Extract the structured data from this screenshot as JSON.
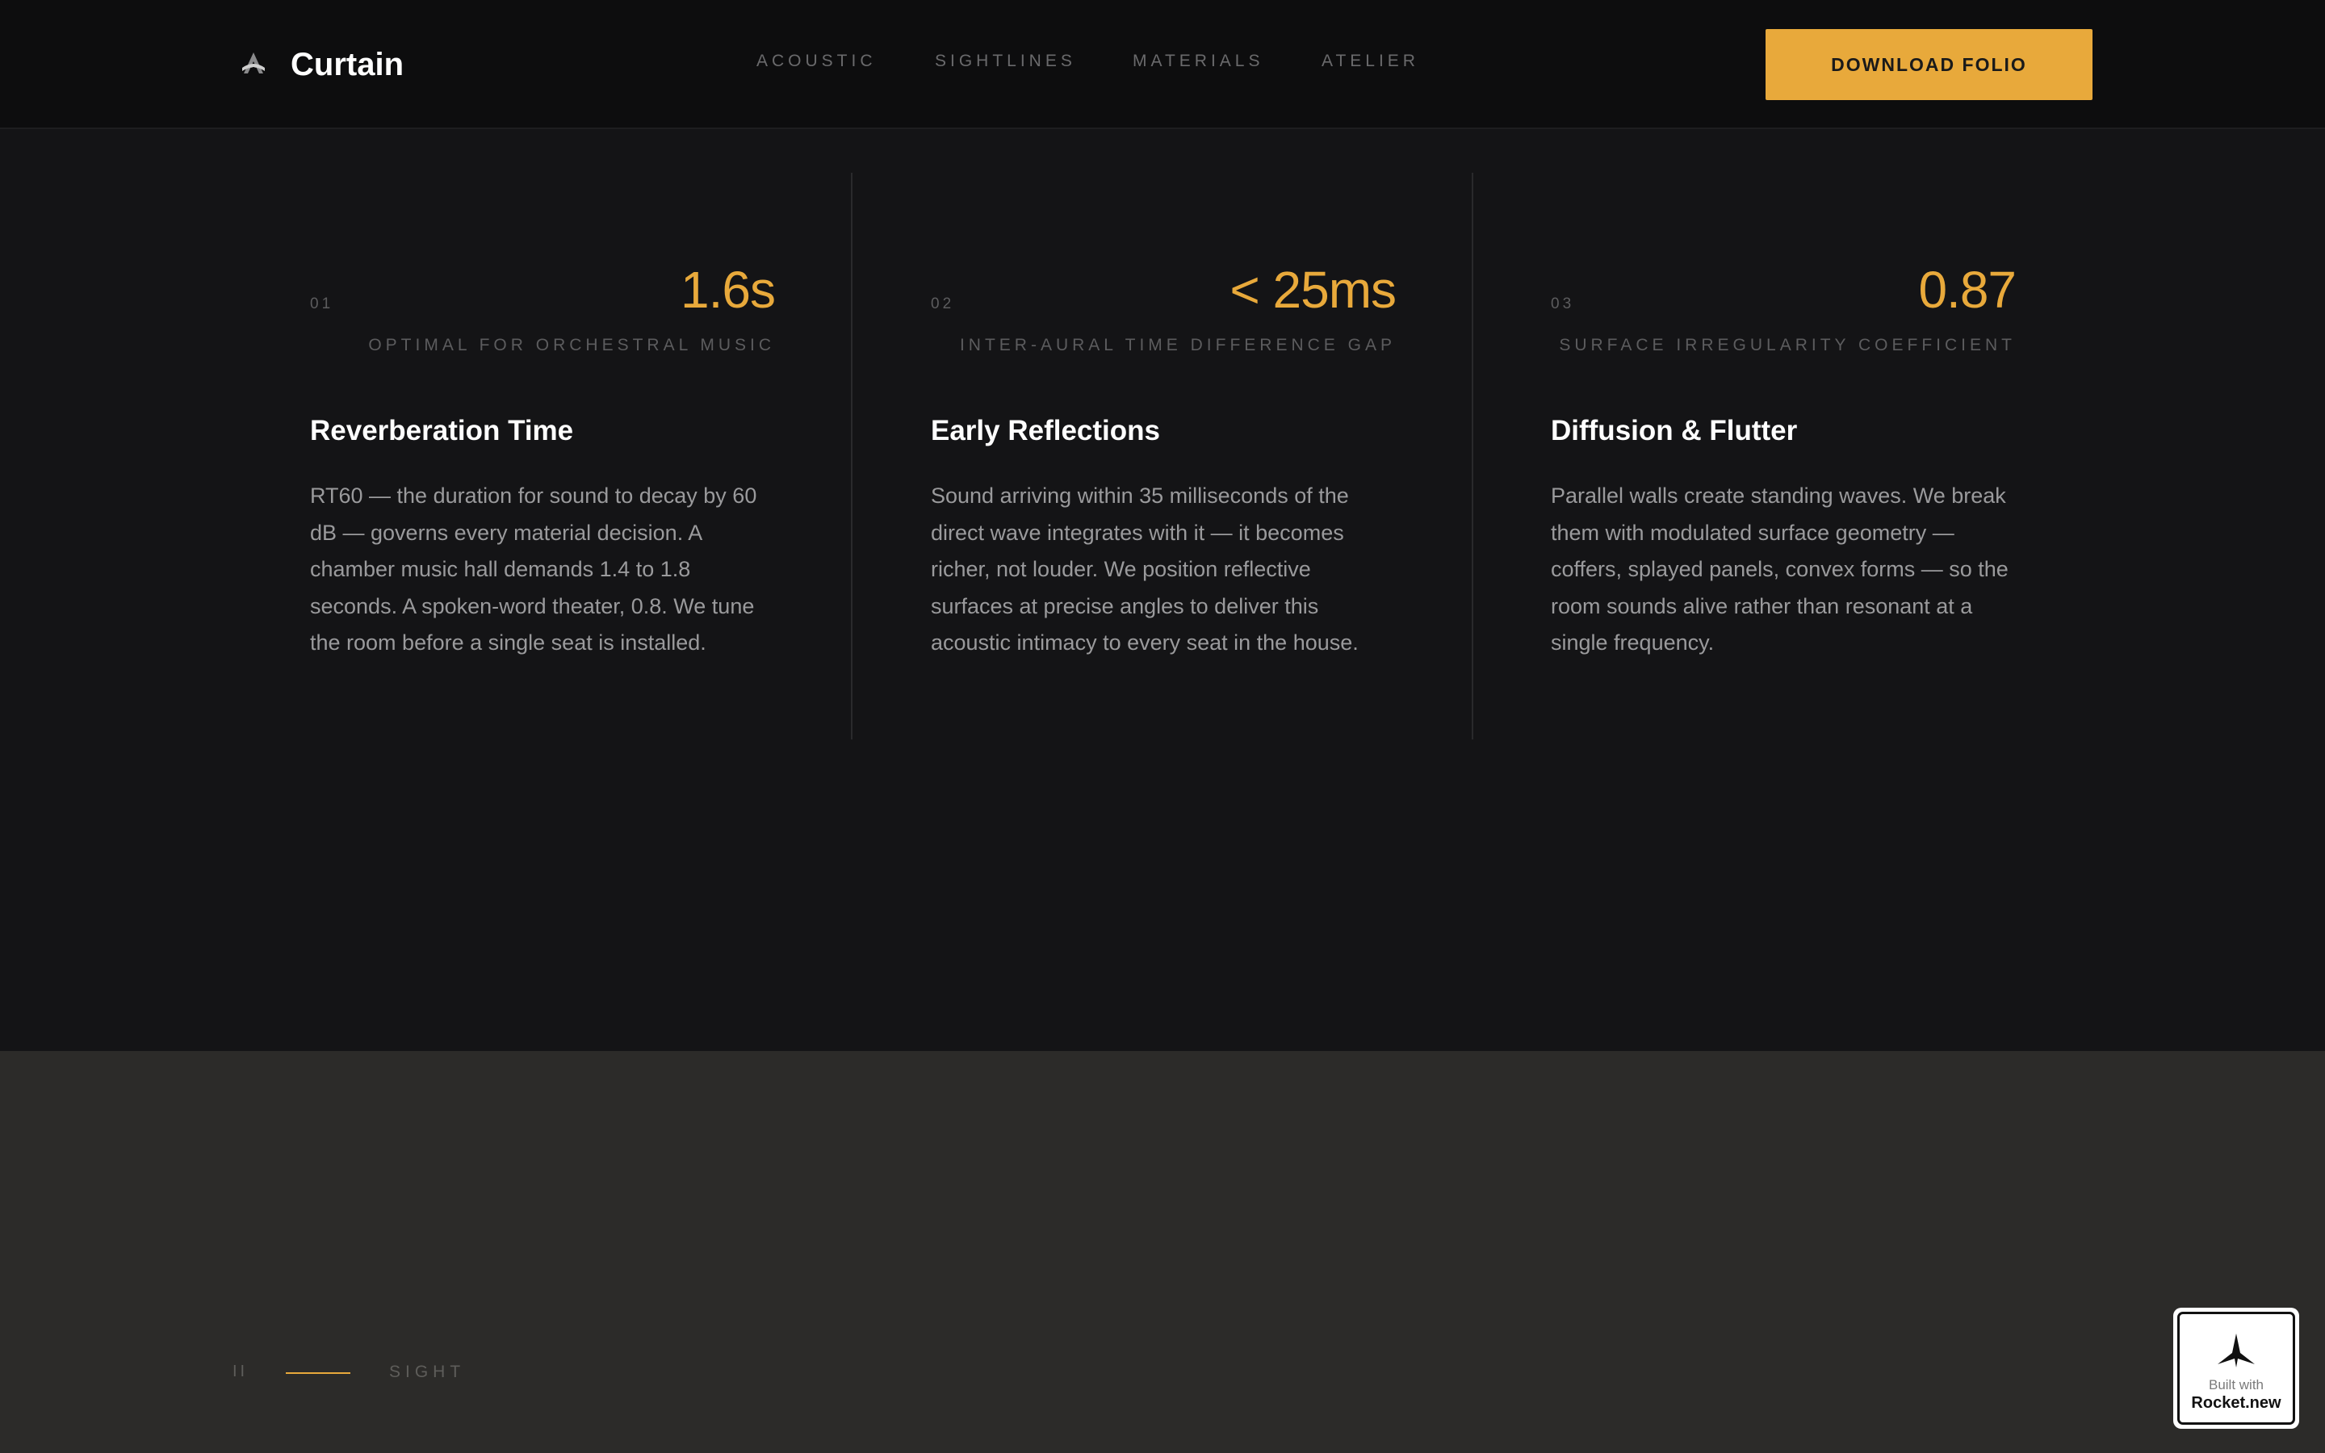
{
  "header": {
    "brand": "Curtain",
    "nav": [
      {
        "label": "ACOUSTIC"
      },
      {
        "label": "SIGHTLINES"
      },
      {
        "label": "MATERIALS"
      },
      {
        "label": "ATELIER"
      }
    ],
    "cta_label": "DOWNLOAD FOLIO"
  },
  "metrics": [
    {
      "num": "01",
      "value": "1.6s",
      "caption": "OPTIMAL FOR ORCHESTRAL MUSIC",
      "title": "Reverberation Time",
      "body": "RT60 — the duration for sound to decay by 60 dB — governs every material decision. A chamber music hall demands 1.4 to 1.8 seconds. A spoken-word theater, 0.8. We tune the room before a single seat is installed."
    },
    {
      "num": "02",
      "value": "< 25ms",
      "caption": "INTER-AURAL TIME DIFFERENCE GAP",
      "title": "Early Reflections",
      "body": "Sound arriving within 35 milliseconds of the direct wave integrates with it — it becomes richer, not louder. We position reflective surfaces at precise angles to deliver this acoustic intimacy to every seat in the house."
    },
    {
      "num": "03",
      "value": "0.87",
      "caption": "SURFACE IRREGULARITY COEFFICIENT",
      "title": "Diffusion & Flutter",
      "body": "Parallel walls create standing waves. We break them with modulated surface geometry — coffers, splayed panels, convex forms — so the room sounds alive rather than resonant at a single frequency."
    }
  ],
  "next_section": {
    "index": "II",
    "label": "SIGHT"
  },
  "badge": {
    "line1": "Built with",
    "line2": "Rocket.new"
  },
  "colors": {
    "accent": "#e8a93b",
    "background": "#141416",
    "header_bg": "#0d0d0e",
    "section2_bg": "#2c2b29"
  },
  "icons": {
    "brand": "theater-mask-icon",
    "badge": "rocket-icon"
  }
}
